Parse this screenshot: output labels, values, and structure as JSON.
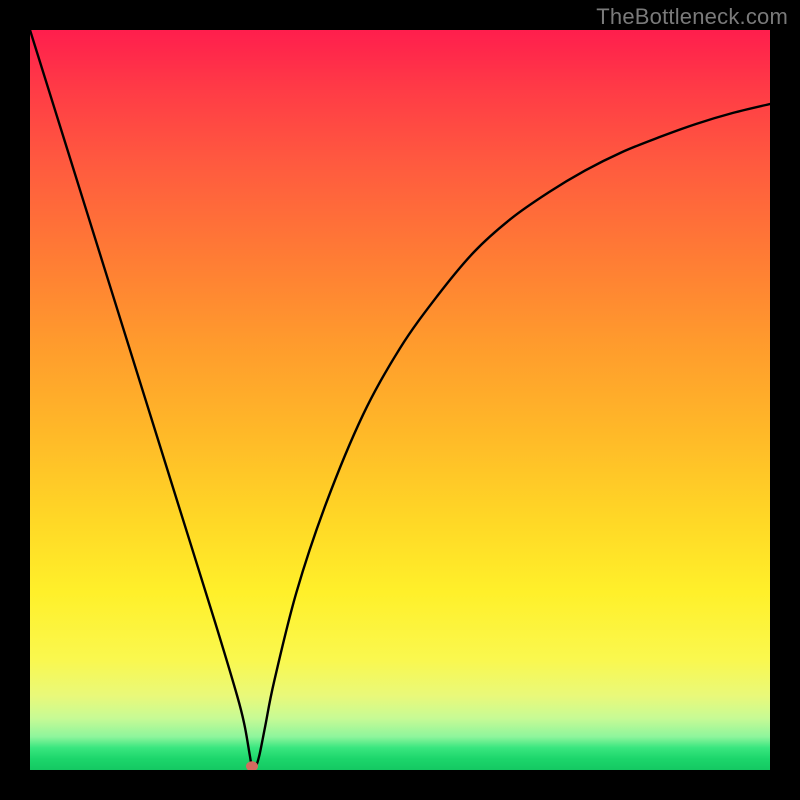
{
  "watermark": "TheBottleneck.com",
  "chart_data": {
    "type": "line",
    "title": "",
    "xlabel": "",
    "ylabel": "",
    "xlim": [
      0,
      100
    ],
    "ylim": [
      0,
      100
    ],
    "background_gradient": {
      "0": "#ff1e4d",
      "50": "#ffba28",
      "85": "#faf84e",
      "97": "#39e67f",
      "100": "#14c862"
    },
    "series": [
      {
        "name": "bottleneck-curve",
        "color": "#000000",
        "x": [
          0,
          5,
          10,
          15,
          20,
          25,
          28,
          29,
          29.7,
          30,
          30.5,
          31,
          31.8,
          33,
          36,
          40,
          45,
          50,
          55,
          60,
          65,
          70,
          75,
          80,
          85,
          90,
          95,
          100
        ],
        "values": [
          100,
          84,
          68,
          52,
          36,
          20,
          10,
          6,
          2,
          0.5,
          0.5,
          2,
          6,
          12,
          24,
          36,
          48,
          57,
          64,
          70,
          74.5,
          78,
          81,
          83.5,
          85.5,
          87.3,
          88.8,
          90
        ]
      }
    ],
    "marker": {
      "name": "minimum-point",
      "x": 30,
      "y": 0.5,
      "color": "#d46a5f",
      "rx": 6,
      "ry": 5
    }
  }
}
